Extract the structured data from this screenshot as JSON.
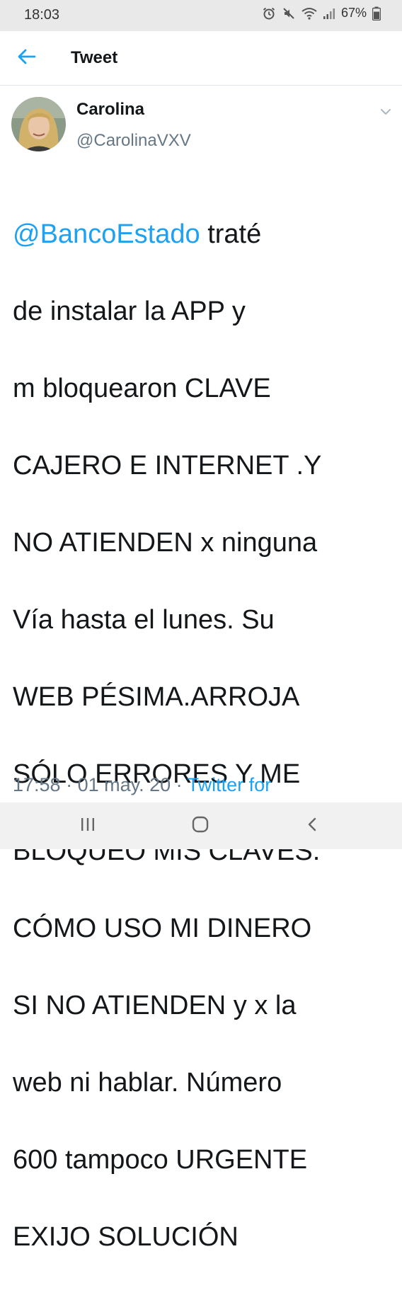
{
  "status_bar": {
    "time": "18:03",
    "battery": "67%",
    "icons": [
      "alarm-icon",
      "mute-icon",
      "wifi-icon",
      "signal-icon",
      "battery-icon"
    ]
  },
  "header": {
    "title": "Tweet",
    "back_icon": "arrow-left-icon",
    "accent": "#1da1f2"
  },
  "tweet": {
    "author_name": "Carolina",
    "author_handle": "@CarolinaVXV",
    "mention": "@BancoEstado",
    "lines": [
      "traté",
      "de instalar la APP y",
      "m bloquearon CLAVE",
      "CAJERO E INTERNET .Y",
      "NO ATIENDEN x ninguna",
      "Vía hasta el lunes. Su",
      "WEB PÉSIMA.ARROJA",
      "SÓLO ERRORES Y ME",
      "BLOQUEO MIS CLAVES.",
      "CÓMO USO MI DINERO",
      "SI NO ATIENDEN y x la",
      "web ni hablar. Número",
      "600 tampoco URGENTE",
      "EXIJO SOLUCIÓN"
    ],
    "time": "17:58",
    "separator": " · ",
    "date": "01 may. 20",
    "source": "Twitter for"
  },
  "nav_bar": {
    "icons": [
      "recent-apps-icon",
      "home-icon",
      "back-icon"
    ]
  }
}
